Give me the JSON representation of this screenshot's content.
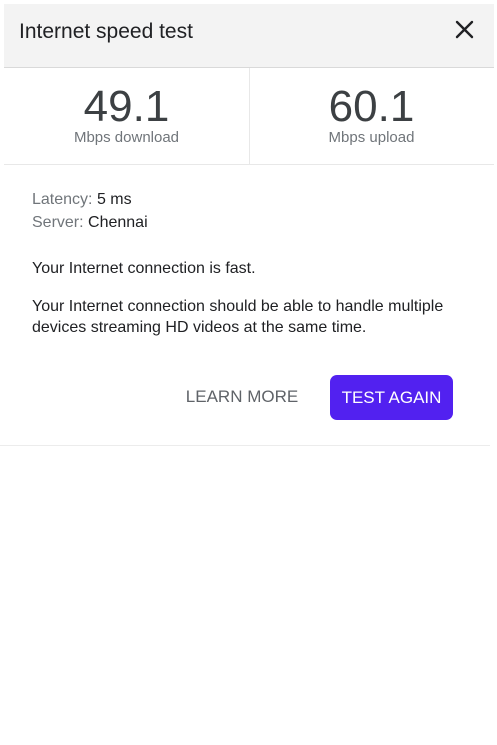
{
  "header": {
    "title": "Internet speed test",
    "close_icon": "close-icon"
  },
  "results": {
    "download": {
      "value": "49.1",
      "label": "Mbps download"
    },
    "upload": {
      "value": "60.1",
      "label": "Mbps upload"
    }
  },
  "details": {
    "latency_key": "Latency:",
    "latency_value": "5 ms",
    "server_key": "Server:",
    "server_value": "Chennai",
    "message_fast": "Your Internet connection is fast.",
    "message_detail": "Your Internet connection should be able to handle multiple devices streaming HD videos at the same time."
  },
  "actions": {
    "learn_more": "LEARN MORE",
    "test_again": "TEST AGAIN"
  },
  "colors": {
    "accent": "#5221f0",
    "header_bg": "#f3f3f3",
    "muted_text": "#70757a",
    "primary_text": "#202124"
  }
}
